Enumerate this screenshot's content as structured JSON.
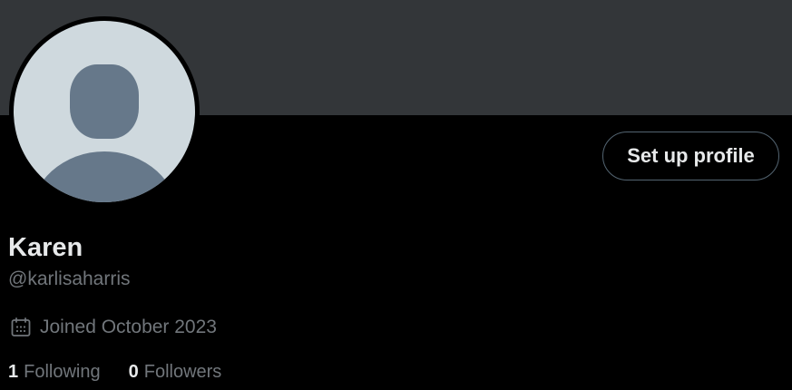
{
  "profile": {
    "display_name": "Karen",
    "handle": "@karlisaharris",
    "joined": "Joined October 2023",
    "setup_button": "Set up profile"
  },
  "stats": {
    "following_count": "1",
    "following_label": "Following",
    "followers_count": "0",
    "followers_label": "Followers"
  },
  "icons": {
    "avatar": "default-avatar-icon",
    "joined": "calendar-icon"
  },
  "colors": {
    "background": "#000000",
    "banner": "#333639",
    "primary_text": "#e7e9ea",
    "secondary_text": "#71767b",
    "avatar_bg": "#cfd9de",
    "avatar_figure": "#66788a",
    "button_border": "#536471"
  }
}
